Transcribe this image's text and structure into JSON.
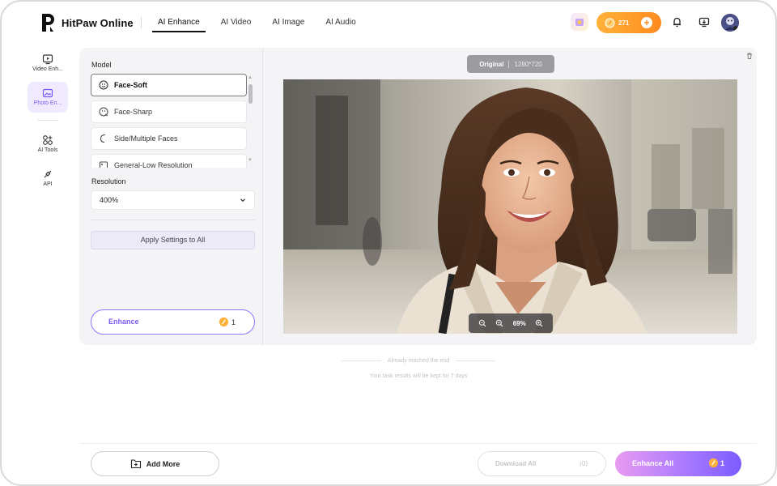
{
  "header": {
    "app_name": "HitPaw Online",
    "nav": [
      {
        "label": "AI Enhance",
        "active": true
      },
      {
        "label": "AI Video",
        "active": false
      },
      {
        "label": "AI Image",
        "active": false
      },
      {
        "label": "AI Audio",
        "active": false
      }
    ],
    "credits": "271",
    "icons": [
      "promo-gift-icon",
      "coin-icon",
      "plus-icon",
      "bell-icon",
      "download-app-icon",
      "avatar"
    ]
  },
  "sidebar": {
    "items": [
      {
        "label": "Video Enh...",
        "icon": "video-enhance-icon",
        "active": false
      },
      {
        "label": "Photo En...",
        "icon": "photo-enhance-icon",
        "active": true
      },
      {
        "label": "AI Tools",
        "icon": "ai-tools-icon",
        "active": false
      },
      {
        "label": "API",
        "icon": "api-icon",
        "active": false
      }
    ]
  },
  "settings": {
    "model_label": "Model",
    "models": [
      {
        "label": "Face-Soft",
        "icon": "face-soft-icon",
        "selected": true
      },
      {
        "label": "Face-Sharp",
        "icon": "face-sharp-icon",
        "selected": false
      },
      {
        "label": "Side/Multiple Faces",
        "icon": "side-faces-icon",
        "selected": false
      },
      {
        "label": "General-Low Resolution",
        "icon": "general-icon",
        "selected": false
      }
    ],
    "resolution_label": "Resolution",
    "resolution_value": "400%",
    "apply_label": "Apply Settings to All",
    "enhance_label": "Enhance",
    "enhance_cost": "1"
  },
  "preview": {
    "badge_label": "Original",
    "badge_resolution": "1280*720",
    "zoom_value": "69%"
  },
  "notes": {
    "end": "Already reached the end",
    "keep": "Your task results will be kept for 7 days"
  },
  "footer": {
    "add_more": "Add More",
    "download_all": "Download All",
    "download_count": "(0)",
    "enhance_all": "Enhance All",
    "enhance_all_cost": "1"
  },
  "colors": {
    "accent": "#7a59f2",
    "credit": "#ff8a1f"
  }
}
